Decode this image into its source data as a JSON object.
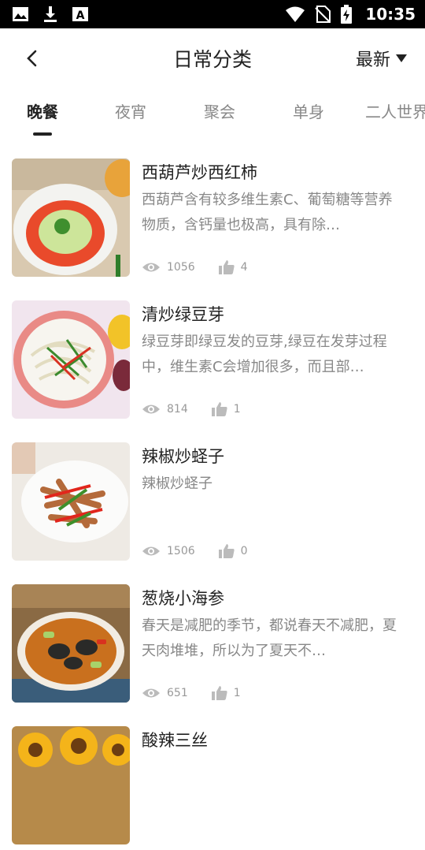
{
  "status_bar": {
    "time": "10:35",
    "icons": [
      "image-icon",
      "download-icon",
      "font-a-icon",
      "wifi-icon",
      "no-sim-icon",
      "battery-charging-icon"
    ]
  },
  "header": {
    "title": "日常分类",
    "sort_label": "最新",
    "back_icon": "chevron-left-icon",
    "sort_icon": "caret-down-icon"
  },
  "tabs": [
    {
      "label": "晚餐",
      "active": true
    },
    {
      "label": "夜宵",
      "active": false
    },
    {
      "label": "聚会",
      "active": false
    },
    {
      "label": "单身",
      "active": false
    },
    {
      "label": "二人世界",
      "active": false
    }
  ],
  "colors": {
    "accent": "#222222",
    "muted": "#888888",
    "meta": "#999999",
    "icon": "#bbbbbb"
  },
  "recipes": [
    {
      "title": "西葫芦炒西红柿",
      "description": "西葫芦含有较多维生素C、葡萄糖等营养物质，含钙量也极高，具有除…",
      "views": "1056",
      "likes": "4"
    },
    {
      "title": "清炒绿豆芽",
      "description": "绿豆芽即绿豆发的豆芽,绿豆在发芽过程中，维生素C会增加很多，而且部…",
      "views": "814",
      "likes": "1"
    },
    {
      "title": "辣椒炒蛏子",
      "description": "辣椒炒蛏子",
      "views": "1506",
      "likes": "0"
    },
    {
      "title": "葱烧小海参",
      "description": "春天是减肥的季节，都说春天不减肥，夏天肉堆堆，所以为了夏天不…",
      "views": "651",
      "likes": "1"
    },
    {
      "title": "酸辣三丝",
      "description": "",
      "views": "",
      "likes": ""
    }
  ]
}
